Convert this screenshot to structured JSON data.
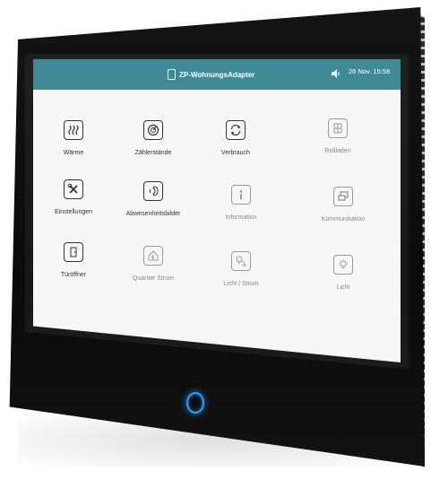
{
  "header": {
    "title": "ZP-WohnungsAdapter",
    "datetime": "26 Nov. 15:58",
    "speaker_icon": "speaker-icon",
    "title_icon": "tablet-icon"
  },
  "tiles": [
    {
      "label": "Wärme",
      "icon": "heating-icon"
    },
    {
      "label": "Zählerstände",
      "icon": "meter-icon"
    },
    {
      "label": "Verbrauch",
      "icon": "refresh-icon"
    },
    {
      "label": "Rollladen",
      "icon": "window-shutter-icon"
    },
    {
      "label": "Einstellungen",
      "icon": "tools-icon"
    },
    {
      "label": "Abwesenheitsbilder",
      "icon": "face-call-icon"
    },
    {
      "label": "Information",
      "icon": "info-icon"
    },
    {
      "label": "Kommunikation",
      "icon": "chat-icon"
    },
    {
      "label": "Türöffner",
      "icon": "door-icon"
    },
    {
      "label": "Quartier Strom",
      "icon": "house-power-icon"
    },
    {
      "label": "Licht / Strom",
      "icon": "bulb-plug-icon"
    },
    {
      "label": "Licht",
      "icon": "bulb-icon"
    }
  ],
  "colors": {
    "header_bg": "#3f8a94",
    "home_button_glow": "#2aa0ff"
  }
}
